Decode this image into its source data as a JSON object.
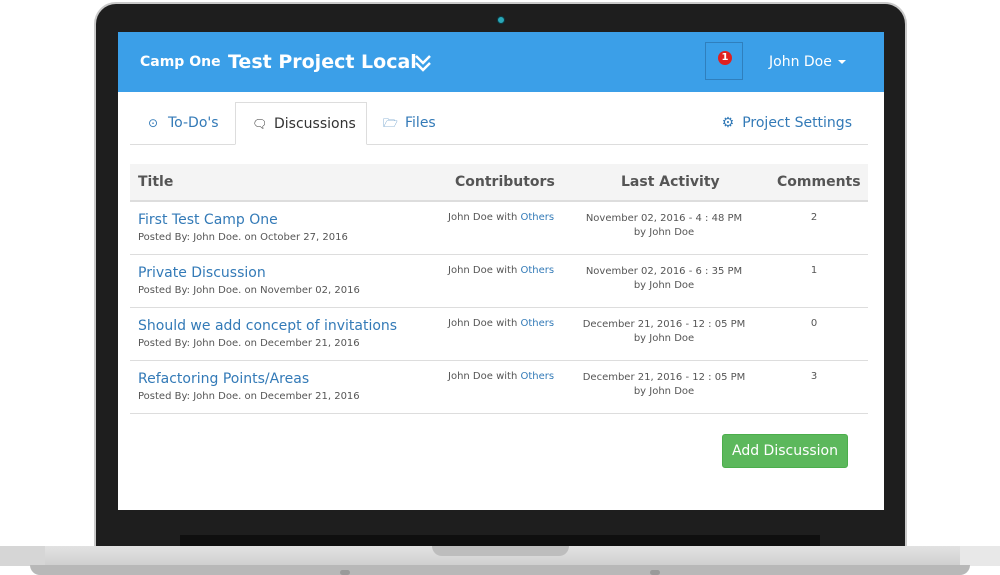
{
  "header": {
    "brand": "Camp One",
    "project_title": "Test Project Local",
    "notification_count": "1",
    "user_name": "John Doe"
  },
  "tabs": [
    {
      "label": "To-Do's",
      "icon": "check-circle-icon",
      "active": false
    },
    {
      "label": "Discussions",
      "icon": "comments-icon",
      "active": true
    },
    {
      "label": "Files",
      "icon": "folder-icon",
      "active": false
    }
  ],
  "settings_label": "Project Settings",
  "table": {
    "headers": [
      "Title",
      "Contributors",
      "Last Activity",
      "Comments"
    ],
    "rows": [
      {
        "title": "First Test Camp One",
        "posted": "Posted By: John Doe. on October 27, 2016",
        "contributor": "John Doe with ",
        "others": "Others",
        "activity_date": "November 02, 2016 - 4 : 48 PM",
        "activity_by": "by John Doe",
        "comments": "2"
      },
      {
        "title": "Private Discussion",
        "posted": "Posted By: John Doe. on November 02, 2016",
        "contributor": "John Doe with ",
        "others": "Others",
        "activity_date": "November 02, 2016 - 6 : 35 PM",
        "activity_by": "by John Doe",
        "comments": "1"
      },
      {
        "title": "Should we add concept of invitations",
        "posted": "Posted By: John Doe. on December 21, 2016",
        "contributor": "John Doe with ",
        "others": "Others",
        "activity_date": "December 21, 2016 - 12 : 05 PM",
        "activity_by": "by John Doe",
        "comments": "0"
      },
      {
        "title": "Refactoring Points/Areas",
        "posted": "Posted By: John Doe. on December 21, 2016",
        "contributor": "John Doe with ",
        "others": "Others",
        "activity_date": "December 21, 2016 - 12 : 05 PM",
        "activity_by": "by John Doe",
        "comments": "3"
      }
    ]
  },
  "add_discussion_label": "Add Discussion",
  "colors": {
    "header": "#3b9fe8",
    "link": "#337ab7",
    "button": "#5cb85c"
  }
}
